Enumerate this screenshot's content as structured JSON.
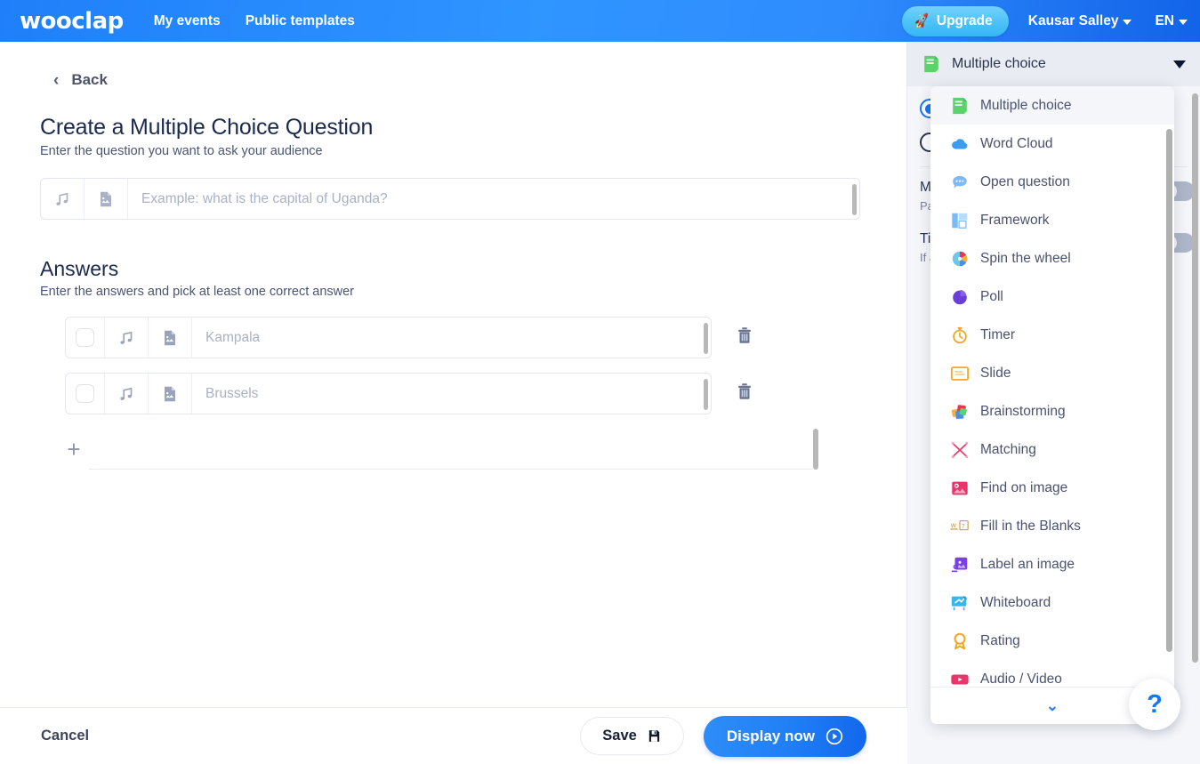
{
  "topnav": {
    "brand": "wooclap",
    "links": [
      {
        "label": "My events"
      },
      {
        "label": "Public templates"
      }
    ],
    "upgrade_label": "Upgrade",
    "upgrade_icon": "rocket-icon",
    "user_name": "Kausar Salley",
    "language": "EN"
  },
  "main": {
    "back_label": "Back",
    "title": "Create a Multiple Choice Question",
    "subtitle": "Enter the question you want to ask your audience",
    "question": {
      "value": "",
      "placeholder": "Example: what is the capital of Uganda?",
      "audio_icon": "music-note-icon",
      "image_icon": "image-file-icon"
    },
    "answers_title": "Answers",
    "answers_subtitle": "Enter the answers and pick at least one correct answer",
    "answers": [
      {
        "value": "",
        "placeholder": "Kampala",
        "checked": false
      },
      {
        "value": "",
        "placeholder": "Brussels",
        "checked": false
      }
    ],
    "add_answer_icon": "plus-icon",
    "delete_icon": "trash-icon"
  },
  "footer": {
    "cancel_label": "Cancel",
    "save_label": "Save",
    "save_icon": "floppy-disk-icon",
    "display_label": "Display now",
    "display_icon": "play-circle-icon"
  },
  "right_panel": {
    "header_label": "Multiple choice",
    "header_icon": "multiple-choice-icon",
    "radios": [
      {
        "label": "",
        "selected": true
      },
      {
        "label": "",
        "selected": false
      }
    ],
    "options": [
      {
        "title": "Mu",
        "desc": "Pa\non",
        "toggle": false
      },
      {
        "title": "Ti",
        "desc": "If \nau\nis ",
        "toggle": false
      }
    ]
  },
  "dropdown": {
    "items": [
      {
        "label": "Multiple choice",
        "icon": "multiple-choice-icon",
        "active": true
      },
      {
        "label": "Word Cloud",
        "icon": "word-cloud-icon",
        "active": false
      },
      {
        "label": "Open question",
        "icon": "open-question-icon",
        "active": false
      },
      {
        "label": "Framework",
        "icon": "framework-icon",
        "active": false
      },
      {
        "label": "Spin the wheel",
        "icon": "spin-the-wheel-icon",
        "active": false
      },
      {
        "label": "Poll",
        "icon": "poll-icon",
        "active": false
      },
      {
        "label": "Timer",
        "icon": "timer-icon",
        "active": false
      },
      {
        "label": "Slide",
        "icon": "slide-icon",
        "active": false
      },
      {
        "label": "Brainstorming",
        "icon": "brainstorming-icon",
        "active": false
      },
      {
        "label": "Matching",
        "icon": "matching-icon",
        "active": false
      },
      {
        "label": "Find on image",
        "icon": "find-on-image-icon",
        "active": false
      },
      {
        "label": "Fill in the Blanks",
        "icon": "fill-in-blanks-icon",
        "active": false
      },
      {
        "label": "Label an image",
        "icon": "label-an-image-icon",
        "active": false
      },
      {
        "label": "Whiteboard",
        "icon": "whiteboard-icon",
        "active": false
      },
      {
        "label": "Rating",
        "icon": "rating-icon",
        "active": false
      },
      {
        "label": "Audio / Video",
        "icon": "audio-video-icon",
        "active": false
      }
    ],
    "more_icon": "chevron-down-icon"
  },
  "help": {
    "label": "?"
  },
  "colors": {
    "brand_blue": "#1f7ffa",
    "upgrade_cyan": "#4fc3f7",
    "accent_blue": "#1678f2",
    "text_dark": "#1b2a4e",
    "text_muted": "#7b8399",
    "panel_bg": "#f4f6fa"
  }
}
